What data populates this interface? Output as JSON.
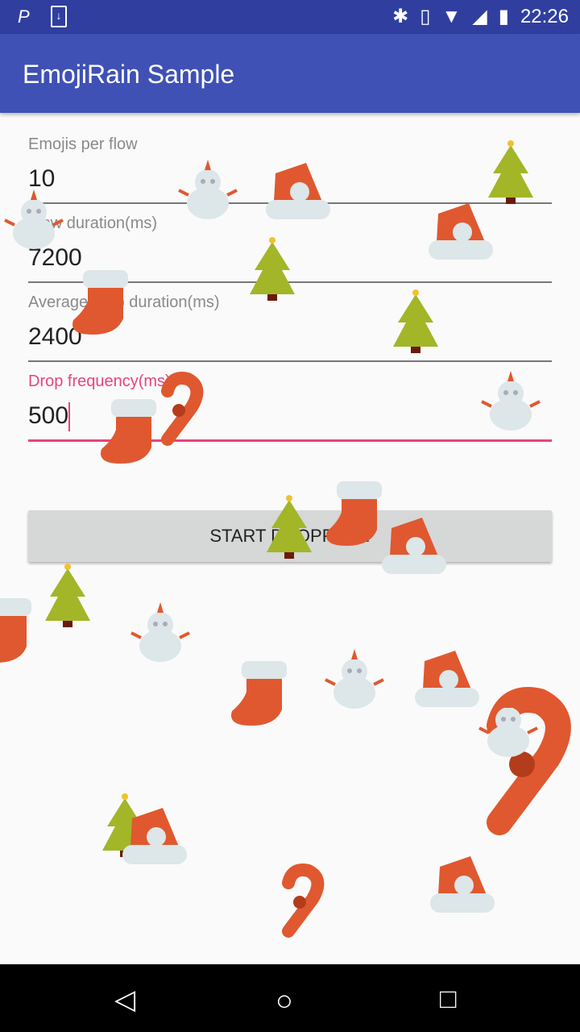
{
  "status_bar": {
    "time": "22:26",
    "icons": [
      "p-icon",
      "download-icon",
      "bluetooth-icon",
      "vibrate-icon",
      "wifi-icon",
      "signal-icon",
      "battery-charging-icon"
    ]
  },
  "app_bar": {
    "title": "EmojiRain Sample"
  },
  "form": {
    "fields": [
      {
        "label": "Emojis per flow",
        "value": "10"
      },
      {
        "label": "Flow duration(ms)",
        "value": "7200"
      },
      {
        "label": "Average drop duration(ms)",
        "value": "2400"
      },
      {
        "label": "Drop frequency(ms)",
        "value": "500"
      }
    ],
    "start_button": "START DROPPING!"
  },
  "colors": {
    "primary": "#3f51b5",
    "primary_dark": "#303f9f",
    "accent": "#e94479"
  },
  "nav_bar": {
    "icons": [
      "back-icon",
      "home-icon",
      "recents-icon"
    ]
  }
}
